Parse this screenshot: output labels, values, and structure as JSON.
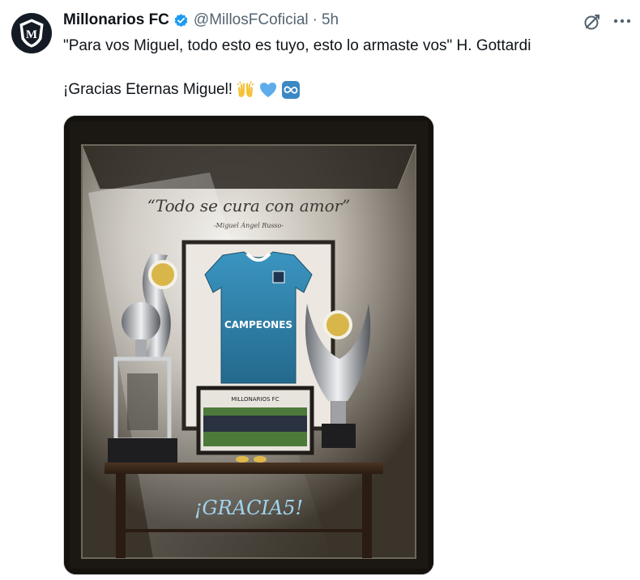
{
  "author": {
    "display_name": "Millonarios FC",
    "handle": "@MillosFCoficial",
    "separator": "·",
    "time": "5h",
    "verified_color": "#1d9bf0"
  },
  "tweet": {
    "line1": "\"Para vos Miguel, todo esto es tuyo, esto lo armaste vos\" H. Gottardi",
    "line2": "¡Gracias Eternas Miguel!",
    "emojis": [
      "raising-hands",
      "light-blue-heart",
      "infinity"
    ]
  },
  "icons": {
    "grok": "grok-icon",
    "more": "more-icon"
  },
  "image": {
    "quote": "“Todo se cura con amor”",
    "attribution": "-Miguel Ángel Russo-",
    "jersey_text": "CAMPEONES",
    "frame_brand": "MILLONARIOS FC",
    "caption": "¡GRACIA5!"
  },
  "colors": {
    "text": "#0f1419",
    "secondary": "#536471",
    "jersey": "#2f7fa8",
    "caption": "#9fd4ec"
  }
}
